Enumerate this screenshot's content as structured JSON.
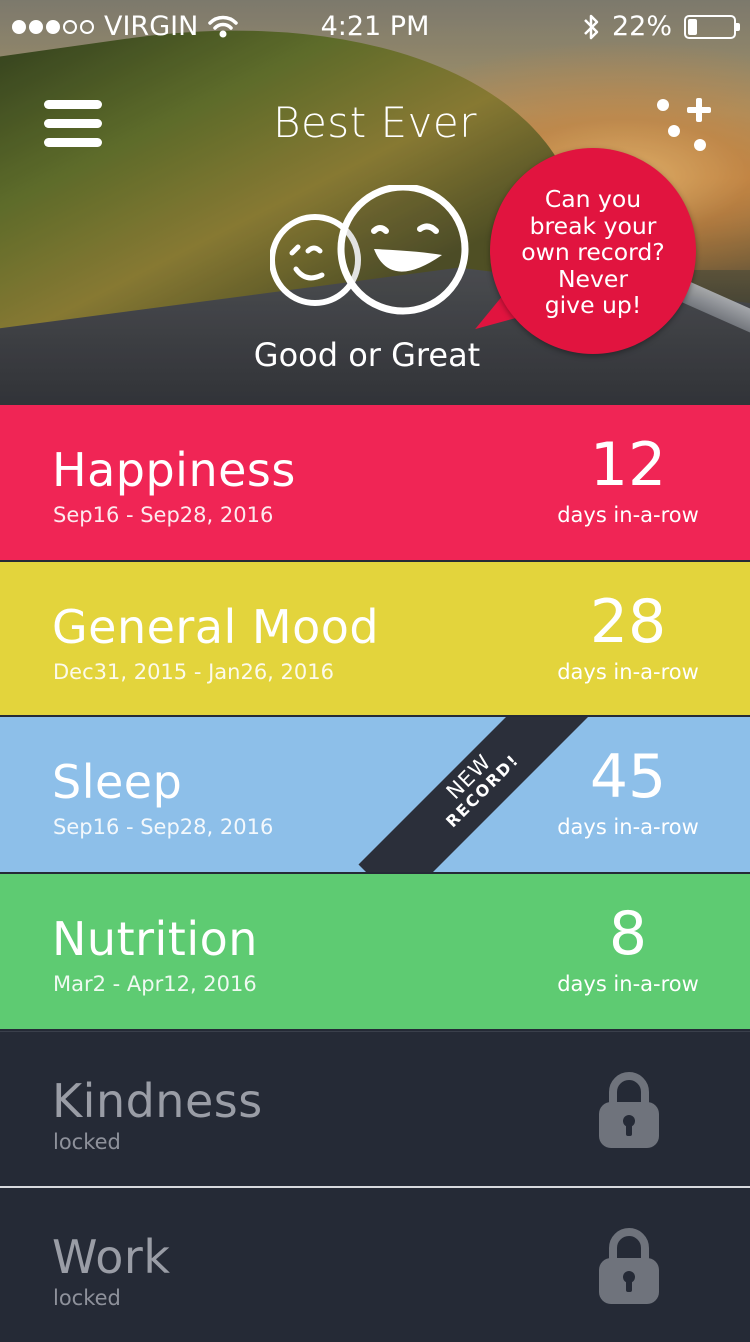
{
  "status_bar": {
    "carrier": "VIRGIN",
    "time": "4:21 PM",
    "battery": "22%"
  },
  "header": {
    "title": "Best Ever",
    "mood_label": "Good or Great"
  },
  "bubble": {
    "text": "Can you\nbreak your\nown record?\nNever\ngive up!"
  },
  "colors": {
    "happiness": "#f02555",
    "general_mood": "#e3d43c",
    "sleep": "#8dbfe9",
    "nutrition": "#5ecb72",
    "locked": "#252a36",
    "bubble": "#e1143f"
  },
  "streaks": [
    {
      "name": "Happiness",
      "dates": "Sep16 - Sep28, 2016",
      "count": "12",
      "unit": "days in-a-row"
    },
    {
      "name": "General Mood",
      "dates": "Dec31, 2015 - Jan26, 2016",
      "count": "28",
      "unit": "days in-a-row"
    },
    {
      "name": "Sleep",
      "dates": "Sep16 - Sep28, 2016",
      "count": "45",
      "unit": "days in-a-row",
      "ribbon": {
        "line1": "NEW",
        "line2": "RECORD!"
      }
    },
    {
      "name": "Nutrition",
      "dates": "Mar2 - Apr12, 2016",
      "count": "8",
      "unit": "days in-a-row"
    },
    {
      "name": "Kindness",
      "status": "locked"
    },
    {
      "name": "Work",
      "status": "locked"
    }
  ],
  "icons": [
    "signal-dots-icon",
    "wifi-icon",
    "bluetooth-icon",
    "battery-icon",
    "hamburger-menu-icon",
    "add-icon",
    "happy-faces-icon",
    "lock-icon"
  ]
}
